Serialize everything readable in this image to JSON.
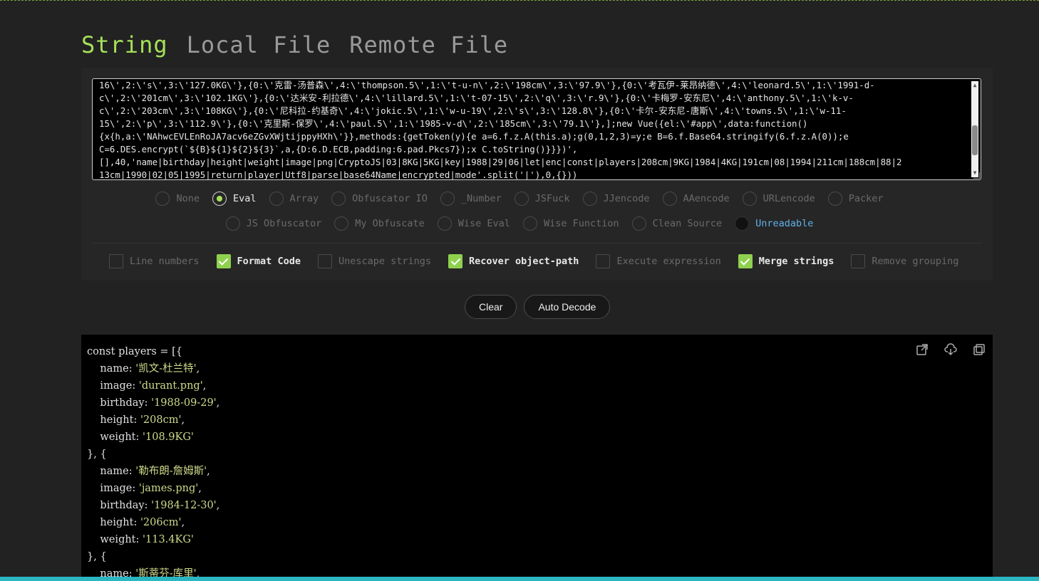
{
  "tabs": [
    "String",
    "Local File",
    "Remote File"
  ],
  "editor_lines": [
    "16\\',2:\\'s\\',3:\\'127.0KG\\'},{0:\\'克雷-汤普森\\',4:\\'thompson.5\\',1:\\'t-u-n\\',2:\\'198cm\\',3:\\'97.9\\'},{0:\\'考瓦伊-莱昂纳德\\',4:\\'leonard.5\\',1:\\'1991-d-",
    "c\\',2:\\'201cm\\',3:\\'102.1KG\\'},{0:\\'达米安-利拉德\\',4:\\'lillard.5\\',1:\\'t-07-15\\',2:\\'q\\',3:\\'r.9\\'},{0:\\'卡梅罗-安东尼\\',4:\\'anthony.5\\',1:\\'k-v-",
    "c\\',2:\\'203cm\\',3:\\'108KG\\'},{0:\\'尼科拉-约基奇\\',4:\\'jokic.5\\',1:\\'w-u-19\\',2:\\'s\\',3:\\'128.8\\'},{0:\\'卡尔-安东尼-唐斯\\',4:\\'towns.5\\',1:\\'w-11-",
    "15\\',2:\\'p\\',3:\\'112.9\\'},{0:\\'克里斯-保罗\\',4:\\'paul.5\\',1:\\'1985-v-d\\',2:\\'185cm\\',3:\\'79.1\\'},];new Vue({el:\\'#app\\',data:function()",
    "{x{h,a:\\'NAhwcEVLEnRoJA7acv6eZGvXWjtijppyHXh\\'}},methods:{getToken(y){e a=6.f.z.A(this.a);g(0,1,2,3)=y;e B=6.f.Base64.stringify(6.f.z.A(0));e",
    "C=6.DES.encrypt(`${B}${1}${2}${3}`,a,{D:6.D.ECB,padding:6.pad.Pkcs7});x C.toString()}}})',",
    "[],40,'name|birthday|height|weight|image|png|CryptoJS|03|8KG|5KG|key|1988|29|06|let|enc|const|players|208cm|9KG|1984|4KG|191cm|08|1994|211cm|188cm|88|2",
    "13cm|1990|02|05|1995|return|player|Utf8|parse|base64Name|encrypted|mode'.split('|'),0,{}))"
  ],
  "radios_row1": [
    "None",
    "Eval",
    "Array",
    "Obfuscator IO",
    "_Number",
    "JSFuck",
    "JJencode",
    "AAencode",
    "URLencode",
    "Packer"
  ],
  "radios_row2": [
    "JS Obfuscator",
    "My Obfuscate",
    "Wise Eval",
    "Wise Function",
    "Clean Source",
    "Unreadable"
  ],
  "selected_radio": "Eval",
  "checkboxes": [
    {
      "label": "Line numbers",
      "checked": false
    },
    {
      "label": "Format Code",
      "checked": true
    },
    {
      "label": "Unescape strings",
      "checked": false
    },
    {
      "label": "Recover object-path",
      "checked": true
    },
    {
      "label": "Execute expression",
      "checked": false
    },
    {
      "label": "Merge strings",
      "checked": true
    },
    {
      "label": "Remove grouping",
      "checked": false
    }
  ],
  "buttons": {
    "clear": "Clear",
    "auto_decode": "Auto Decode"
  },
  "output": {
    "decl": "const players = [{",
    "players": [
      {
        "name": "'凯文-杜兰特'",
        "image": "'durant.png'",
        "birthday": "'1988-09-29'",
        "height": "'208cm'",
        "weight": "'108.9KG'"
      },
      {
        "name": "'勒布朗-詹姆斯'",
        "image": "'james.png'",
        "birthday": "'1984-12-30'",
        "height": "'206cm'",
        "weight": "'113.4KG'"
      },
      {
        "name": "'斯蒂芬-库里'"
      }
    ],
    "separator": "}, {",
    "icons": [
      "open-external-icon",
      "download-icon",
      "copy-icon"
    ]
  },
  "colors": {
    "accent": "#a6e05a",
    "highlight": "#5fb0e8",
    "check": "#8fd14f",
    "bottom_bar": "#2bb6c2"
  }
}
